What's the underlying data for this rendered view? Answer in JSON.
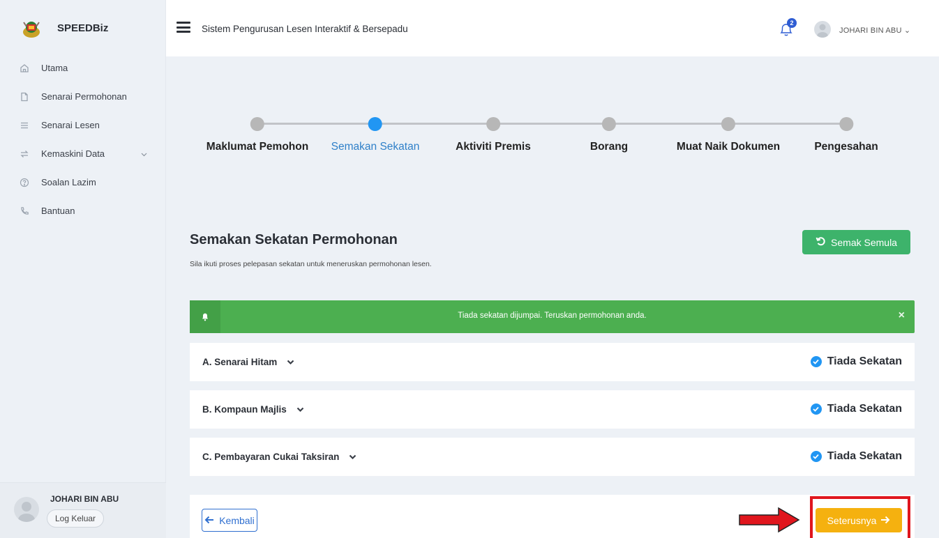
{
  "app": {
    "brand": "SPEEDBiz",
    "system_title": "Sistem Pengurusan Lesen Interaktif & Bersepadu"
  },
  "header": {
    "notification_count": "2",
    "user_name": "JOHARI BIN ABU"
  },
  "sidebar": {
    "items": [
      {
        "label": "Utama",
        "icon": "home-icon"
      },
      {
        "label": "Senarai Permohonan",
        "icon": "file-icon"
      },
      {
        "label": "Senarai Lesen",
        "icon": "list-icon"
      },
      {
        "label": "Kemaskini Data",
        "icon": "sync-icon",
        "has_submenu": true
      },
      {
        "label": "Soalan Lazim",
        "icon": "help-circle-icon"
      },
      {
        "label": "Bantuan",
        "icon": "phone-icon"
      }
    ],
    "user": {
      "name": "JOHARI BIN ABU",
      "logout_label": "Log Keluar"
    }
  },
  "stepper": {
    "steps": [
      {
        "label": "Maklumat Pemohon",
        "active": false
      },
      {
        "label": "Semakan Sekatan",
        "active": true
      },
      {
        "label": "Aktiviti Premis",
        "active": false
      },
      {
        "label": "Borang",
        "active": false
      },
      {
        "label": "Muat Naik Dokumen",
        "active": false
      },
      {
        "label": "Pengesahan",
        "active": false
      }
    ]
  },
  "section": {
    "title": "Semakan Sekatan Permohonan",
    "subtitle": "Sila ikuti proses pelepasan sekatan untuk meneruskan permohonan lesen.",
    "reset_label": "Semak Semula"
  },
  "alert": {
    "message": "Tiada sekatan dijumpai. Teruskan permohonan anda.",
    "close": "×"
  },
  "checks": [
    {
      "title": "A. Senarai Hitam",
      "status": "Tiada Sekatan"
    },
    {
      "title": "B. Kompaun Majlis",
      "status": "Tiada Sekatan"
    },
    {
      "title": "C. Pembayaran Cukai Taksiran",
      "status": "Tiada Sekatan"
    }
  ],
  "actions": {
    "back_label": "Kembali",
    "next_label": "Seterusnya"
  },
  "colors": {
    "accent_blue": "#2196f3",
    "success_green": "#4caf50",
    "next_yellow": "#f5b10f",
    "highlight_red": "#e0161d"
  }
}
